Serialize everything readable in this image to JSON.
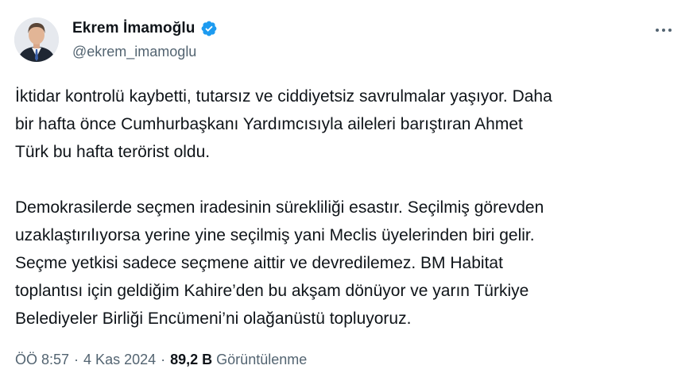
{
  "author": {
    "display_name": "Ekrem İmamoğlu",
    "handle": "@ekrem_imamoglu",
    "verified": true,
    "verified_color": "#1d9bf0"
  },
  "tweet": {
    "paragraphs": [
      "İktidar kontrolü kaybetti, tutarsız ve ciddiyetsiz savrulmalar yaşıyor. Daha\nbir hafta önce Cumhurbaşkanı Yardımcısıyla aileleri barıştıran Ahmet\nTürk bu hafta terörist oldu.",
      "Demokrasilerde seçmen iradesinin sürekliliği esastır. Seçilmiş görevden\nuzaklaştırılıyorsa yerine yine seçilmiş yani Meclis üyelerinden biri gelir.\nSeçme yetkisi sadece seçmene aittir ve devredilemez. BM Habitat\ntoplantısı için geldiğim Kahire’den bu akşam dönüyor ve yarın Türkiye\nBelediyeler Birliği Encümeni’ni olağanüstü topluyoruz."
    ]
  },
  "meta": {
    "time": "ÖÖ 8:57",
    "separator": "·",
    "date": "4 Kas 2024",
    "views_count": "89,2 B",
    "views_label": "Görüntülenme"
  },
  "icons": {
    "more": "more-options-icon",
    "verified": "verified-badge-icon",
    "avatar": "profile-avatar"
  },
  "colors": {
    "text_primary": "#0f1419",
    "text_secondary": "#536471",
    "background": "#ffffff"
  }
}
